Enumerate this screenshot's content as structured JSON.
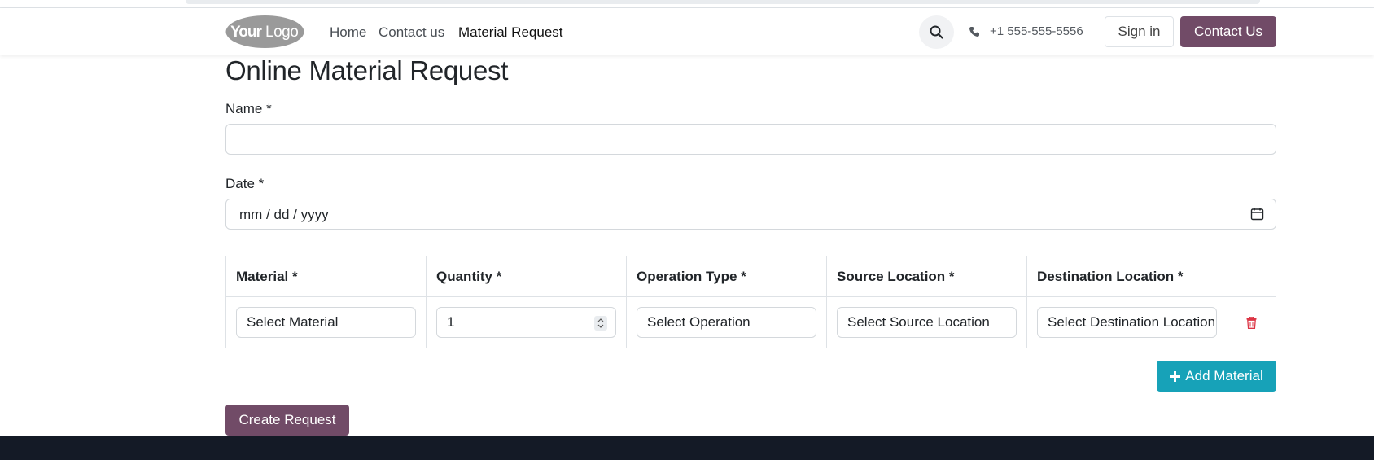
{
  "header": {
    "logo_text": "YourLogo",
    "nav": [
      {
        "label": "Home"
      },
      {
        "label": "Contact us"
      },
      {
        "label": "Material Request"
      }
    ],
    "phone": "+1 555-555-5556",
    "signin_label": "Sign in",
    "contact_label": "Contact Us"
  },
  "form": {
    "title": "Online Material Request",
    "name_label": "Name *",
    "name_value": "",
    "date_label": "Date *",
    "date_placeholder": "mm / dd / yyyy"
  },
  "table": {
    "columns": [
      "Material *",
      "Quantity *",
      "Operation Type *",
      "Source Location *",
      "Destination Location *",
      ""
    ],
    "row": {
      "material": "Select Material",
      "quantity": "1",
      "operation": "Select Operation",
      "source": "Select Source Location",
      "destination": "Select Destination Location"
    }
  },
  "actions": {
    "add_material": "Add Material",
    "create_request": "Create Request"
  },
  "colors": {
    "primary": "#714b67",
    "info": "#17a2b8",
    "danger": "#dc3545",
    "footer": "#141a26"
  }
}
